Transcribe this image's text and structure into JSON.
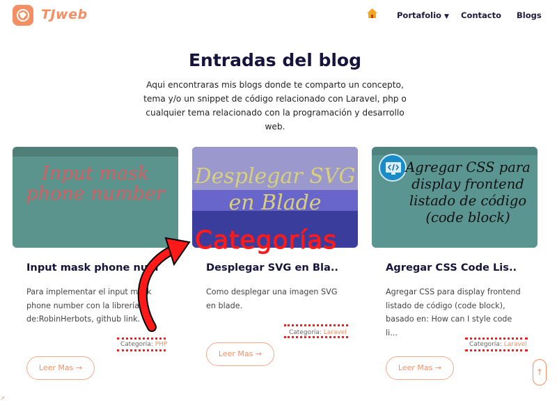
{
  "header": {
    "brand": "TJweb",
    "nav": {
      "home_icon": "home-icon",
      "portafolio": "Portafolio",
      "contacto": "Contacto",
      "blogs": "Blogs"
    }
  },
  "main": {
    "title": "Entradas del blog",
    "intro": "Aqui encontraras mis blogs donde te comparto un concepto, tema y/o un snippet de código relacionado con Laravel, php o cualquier tema relacionado con la programación y desarrollo web."
  },
  "cards": [
    {
      "thumb_text": "Input mask phone number",
      "title": "Input mask phone num",
      "description": "Para implementar el input mask phone number con la librería de:RobinHerbots, github link.",
      "category_label": "Categoría:",
      "category_value": "PHP",
      "button": "Leer Mas"
    },
    {
      "thumb_text": "Desplegar SVG en Blade",
      "title": "Desplegar SVG en Bla..",
      "description": "Como desplegar una imagen SVG en blade.",
      "category_label": "Categoría:",
      "category_value": "Laravel",
      "button": "Leer Mas"
    },
    {
      "thumb_text": "Agregar CSS para display frontend listado de código (code block)",
      "title": "Agregar CSS Code Lis..",
      "description": "Agregar CSS para display frontend listado de código (code block), basado en: How can I style code li...",
      "category_label": "Categoría:",
      "category_value": "Laravel",
      "button": "Leer Mas"
    }
  ],
  "annotation": {
    "label": "Categorías"
  },
  "colors": {
    "accent": "#f48e63",
    "heading": "#16133c",
    "annotation": "#ff1a1a"
  }
}
